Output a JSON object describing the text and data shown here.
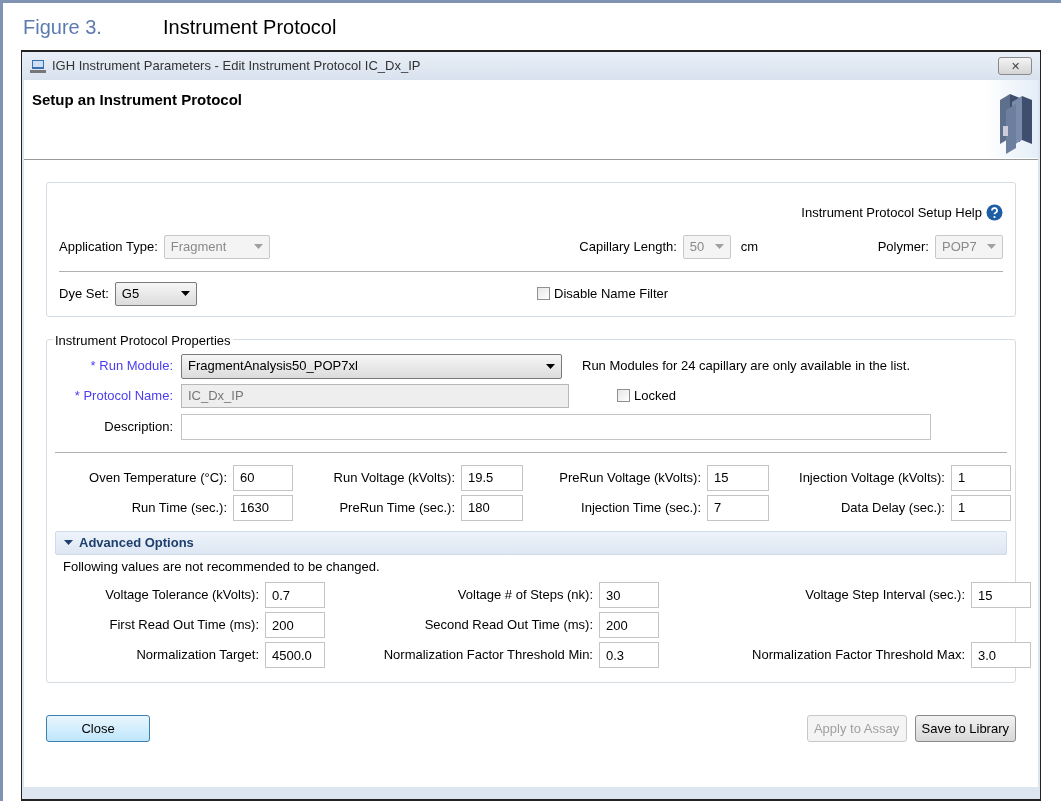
{
  "figure": {
    "number": "Figure 3.",
    "title": "Instrument Protocol"
  },
  "window": {
    "title": "IGH Instrument Parameters - Edit Instrument Protocol IC_Dx_IP",
    "close": "✕"
  },
  "header": {
    "title": "Setup an Instrument Protocol"
  },
  "setup": {
    "help_link": "Instrument Protocol Setup Help",
    "application_type": {
      "label": "Application Type:",
      "value": "Fragment",
      "disabled": true
    },
    "capillary_length": {
      "label": "Capillary Length:",
      "value": "50",
      "disabled": true,
      "unit": "cm"
    },
    "polymer": {
      "label": "Polymer:",
      "value": "POP7",
      "disabled": true
    },
    "dye_set": {
      "label": "Dye Set:",
      "value": "G5",
      "disabled": false
    },
    "disable_name_filter": {
      "label": "Disable Name Filter",
      "checked": false
    }
  },
  "properties": {
    "title": "Instrument Protocol Properties",
    "run_module": {
      "label": "Run Module:",
      "required": true,
      "value": "FragmentAnalysis50_POP7xl",
      "note": "Run Modules for 24 capillary are only available in the list."
    },
    "protocol_name": {
      "label": "Protocol Name:",
      "required": true,
      "value": "IC_Dx_IP",
      "disabled": true
    },
    "locked": {
      "label": "Locked",
      "checked": false
    },
    "required_mark": "*",
    "description": {
      "label": "Description:",
      "required": false
    },
    "parameters": [
      [
        {
          "label": "Oven Temperature (°C):",
          "value": "60"
        },
        {
          "label": "Run Voltage (kVolts):",
          "value": "19.5"
        },
        {
          "label": "PreRun Voltage (kVolts):",
          "value": "15"
        },
        {
          "label": "Injection Voltage (kVolts):",
          "value": "1"
        }
      ],
      [
        {
          "label": "Run Time (sec.):",
          "value": "1630"
        },
        {
          "label": "PreRun Time (sec.):",
          "value": "180"
        },
        {
          "label": "Injection Time (sec.):",
          "value": "7"
        },
        {
          "label": "Data Delay (sec.):",
          "value": "1"
        }
      ]
    ]
  },
  "advanced": {
    "title": "Advanced Options",
    "expanded": true,
    "note": "Following values are not recommended to be changed.",
    "parameters": [
      [
        {
          "label": "Voltage Tolerance (kVolts):",
          "value": "0.7"
        },
        {
          "label": "Voltage # of Steps (nk):",
          "value": "30"
        },
        {
          "label": "Voltage Step Interval (sec.):",
          "value": "15"
        }
      ],
      [
        {
          "label": "First Read Out Time (ms):",
          "value": "200"
        },
        {
          "label": "Second Read Out Time (ms):",
          "value": "200"
        }
      ],
      [
        {
          "label": "Normalization Target:",
          "value": "4500.0"
        },
        {
          "label": "Normalization Factor Threshold Min:",
          "value": "0.3"
        },
        {
          "label": "Normalization Factor Threshold Max:",
          "value": "3.0"
        }
      ]
    ]
  },
  "buttons": [
    {
      "label": "Close",
      "default": true,
      "disabled": false
    },
    {
      "label": "Apply to Assay",
      "default": false,
      "disabled": true
    },
    {
      "label": "Save to Library",
      "default": false,
      "disabled": false
    }
  ]
}
